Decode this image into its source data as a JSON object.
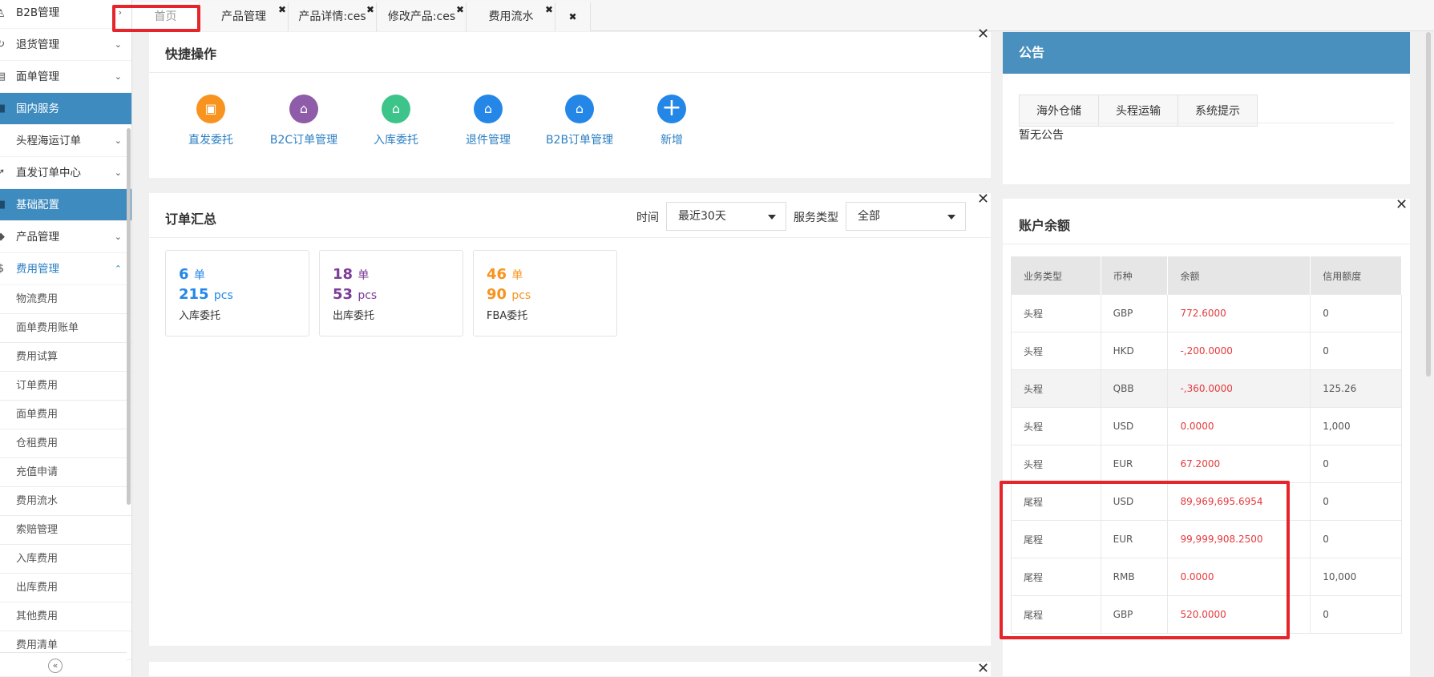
{
  "sidebar": {
    "menu": [
      {
        "label": "B2B管理",
        "icon": "user-icon",
        "chev": "›",
        "active": false
      },
      {
        "label": "退货管理",
        "icon": "refresh-icon",
        "chev": "⌄",
        "active": false
      },
      {
        "label": "面单管理",
        "icon": "document-icon",
        "chev": "⌄",
        "active": false
      },
      {
        "label": "国内服务",
        "icon": "square-icon",
        "chev": "",
        "active": true
      },
      {
        "label": "头程海运订单",
        "icon": "",
        "chev": "⌄",
        "active": false
      },
      {
        "label": "直发订单中心",
        "icon": "send-icon",
        "chev": "⌄",
        "active": false
      },
      {
        "label": "基础配置",
        "icon": "square-icon",
        "chev": "",
        "active": true
      },
      {
        "label": "产品管理",
        "icon": "diamond-icon",
        "chev": "⌄",
        "active": false
      },
      {
        "label": "费用管理",
        "icon": "money-icon",
        "chev": "⌃",
        "active": false,
        "current": true
      }
    ],
    "sub_items": [
      "物流费用",
      "面单费用账单",
      "费用试算",
      "订单费用",
      "面单费用",
      "仓租费用",
      "充值申请",
      "费用流水",
      "索赔管理",
      "入库费用",
      "出库费用",
      "其他费用",
      "费用清单"
    ],
    "collapse_glyph": "«"
  },
  "tabs": [
    {
      "label": "首页",
      "close": ""
    },
    {
      "label": "产品管理",
      "close": "✖"
    },
    {
      "label": "产品详情:ces",
      "close": "✖"
    },
    {
      "label": "修改产品:ces",
      "close": "✖"
    },
    {
      "label": "费用流水",
      "close": "✖"
    },
    {
      "label": "",
      "close": "✖"
    }
  ],
  "quick_ops": {
    "title": "快捷操作",
    "items": [
      {
        "label": "直发委托",
        "icon": "box-icon",
        "color": "#f7931e"
      },
      {
        "label": "B2C订单管理",
        "icon": "house-up-icon",
        "color": "#8e5ca8"
      },
      {
        "label": "入库委托",
        "icon": "house-down-icon",
        "color": "#3cc48a"
      },
      {
        "label": "退件管理",
        "icon": "house-return-icon",
        "color": "#2487e8"
      },
      {
        "label": "B2B订单管理",
        "icon": "house-return-icon",
        "color": "#2487e8"
      },
      {
        "label": "新增",
        "icon": "plus-icon",
        "color": "#2487e8"
      }
    ]
  },
  "order_summary": {
    "title": "订单汇总",
    "time_label": "时间",
    "time_value": "最近30天",
    "service_label": "服务类型",
    "service_value": "全部",
    "cards": [
      {
        "orders": "6",
        "unit_order": "单",
        "pcs": "215",
        "unit_pcs": "pcs",
        "label": "入库委托",
        "color": "#2487e8"
      },
      {
        "orders": "18",
        "unit_order": "单",
        "pcs": "53",
        "unit_pcs": "pcs",
        "label": "出库委托",
        "color": "#7d3c98"
      },
      {
        "orders": "46",
        "unit_order": "单",
        "pcs": "90",
        "unit_pcs": "pcs",
        "label": "FBA委托",
        "color": "#f7931e"
      }
    ]
  },
  "notice": {
    "title": "公告",
    "tabs": [
      "海外仓储",
      "头程运输",
      "系统提示"
    ],
    "empty_text": "暂无公告"
  },
  "balance": {
    "title": "账户余额",
    "columns": [
      "业务类型",
      "币种",
      "余额",
      "信用额度"
    ],
    "rows": [
      [
        "头程",
        "GBP",
        "772.6000",
        "0"
      ],
      [
        "头程",
        "HKD",
        "-,200.0000",
        "0"
      ],
      [
        "头程",
        "QBB",
        "-,360.0000",
        "125.26"
      ],
      [
        "头程",
        "USD",
        "0.0000",
        "1,000"
      ],
      [
        "头程",
        "EUR",
        "67.2000",
        "0"
      ],
      [
        "尾程",
        "USD",
        "89,969,695.6954",
        "0"
      ],
      [
        "尾程",
        "EUR",
        "99,999,908.2500",
        "0"
      ],
      [
        "尾程",
        "RMB",
        "0.0000",
        "10,000"
      ],
      [
        "尾程",
        "GBP",
        "520.0000",
        "0"
      ]
    ]
  },
  "close_glyph": "✕"
}
